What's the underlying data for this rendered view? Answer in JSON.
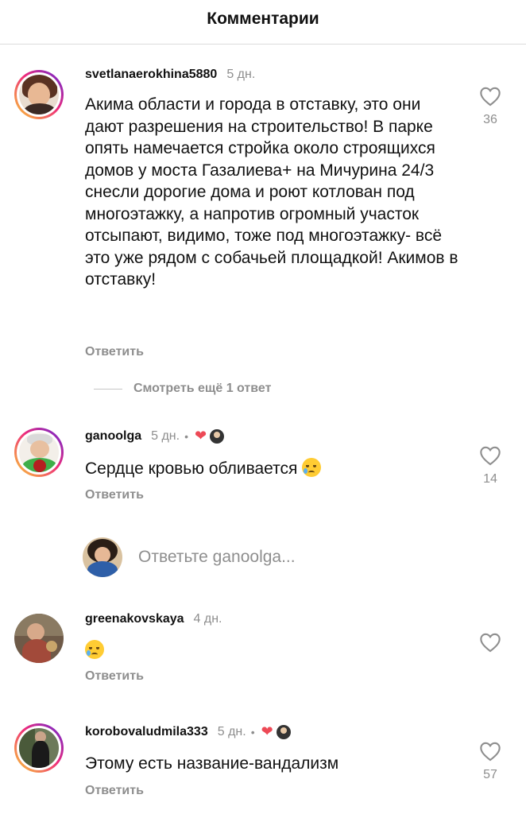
{
  "header": {
    "title": "Комментарии"
  },
  "comments": [
    {
      "username": "svetlanaerokhina5880",
      "time": "5 дн.",
      "text": "Акима области и города в отставку, это они дают разрешения на строительство! В парке опять намечается стройка около строящихся домов у моста Газалиева+ на Мичурина 24/3 снесли дорогие дома и роют котлован под многоэтажку, а напротив огромный участок отсыпают, видимо, тоже под многоэтажку- всё это уже рядом с собачьей площадкой! Акимов в отставку!",
      "reply_label": "Ответить",
      "likes": "36",
      "view_more": "Смотреть ещё 1 ответ"
    },
    {
      "username": "ganoolga",
      "time": "5 дн.",
      "dot": "•",
      "text": "Сердце кровью обливается",
      "reply_label": "Ответить",
      "likes": "14"
    },
    {
      "username": "greenakovskaya",
      "time": "4 дн.",
      "reply_label": "Ответить",
      "likes": ""
    },
    {
      "username": "korobovaludmila333",
      "time": "5 дн.",
      "dot": "•",
      "text": "Этому есть название-вандализм",
      "reply_label": "Ответить",
      "likes": "57"
    }
  ],
  "reply_box": {
    "placeholder": "Ответьте ganoolga..."
  },
  "colors": {
    "secondary_text": "#8e8e8e",
    "like_red": "#ed4956",
    "story_ring": "#ee2a7b"
  },
  "icons": {
    "like": "heart-outline-icon",
    "author_like": "heart-filled-icon",
    "emoji": "crying-face-emoji"
  }
}
